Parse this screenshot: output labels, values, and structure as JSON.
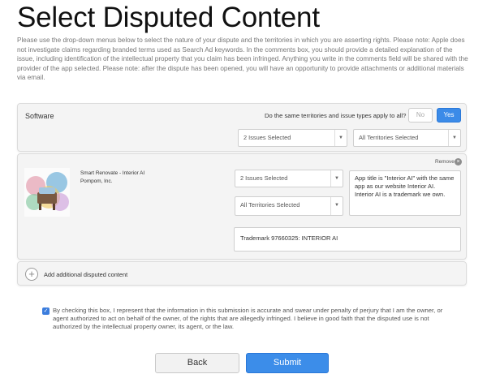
{
  "page": {
    "title": "Select Disputed Content",
    "intro": "Please use the drop-down menus below to select the nature of your dispute and the territories in which you are asserting rights. Please note: Apple does not investigate claims regarding branded terms used as Search Ad keywords. In the comments box, you should provide a detailed explanation of the issue, including identification of the intellectual property that you claim has been infringed. Anything you write in the comments field will be shared with the provider of the app selected. Please note: after the dispute has been opened, you will have an opportunity to provide attachments or additional materials via email."
  },
  "software_panel": {
    "label": "Software",
    "question": "Do the same territories and issue types apply to all?",
    "no_label": "No",
    "yes_label": "Yes",
    "issues_select": "2 Issues Selected",
    "territories_select": "All Territories Selected"
  },
  "content_item": {
    "remove_label": "Remove",
    "app_name": "Smart Renovate - Interior AI",
    "developer": "Pompom, Inc.",
    "issues_select": "2 Issues Selected",
    "territories_select": "All Territories Selected",
    "comment": "App title is \"Interior AI\" with the same app as our website Interior AI. Interior AI is a trademark we own.",
    "trademark": "Trademark 97660325: INTERIOR AI"
  },
  "add_content": {
    "label": "Add additional disputed content"
  },
  "attestation": {
    "checked": true,
    "text": "By checking this box, I represent that the information in this submission is accurate and swear under penalty of perjury that I am the owner, or agent authorized to act on behalf of the owner, of the rights that are allegedly infringed. I believe in good faith that the disputed use is not authorized by the intellectual property owner, its agent, or the law."
  },
  "actions": {
    "back_label": "Back",
    "submit_label": "Submit"
  },
  "icons": {
    "caret": "chevron-down-icon",
    "remove": "close-circle-icon",
    "add": "plus-circle-icon",
    "check": "checkbox-checked-icon",
    "app": "app-thumbnail"
  },
  "colors": {
    "accent": "#3c8de9",
    "panel_bg": "#f4f4f4"
  }
}
